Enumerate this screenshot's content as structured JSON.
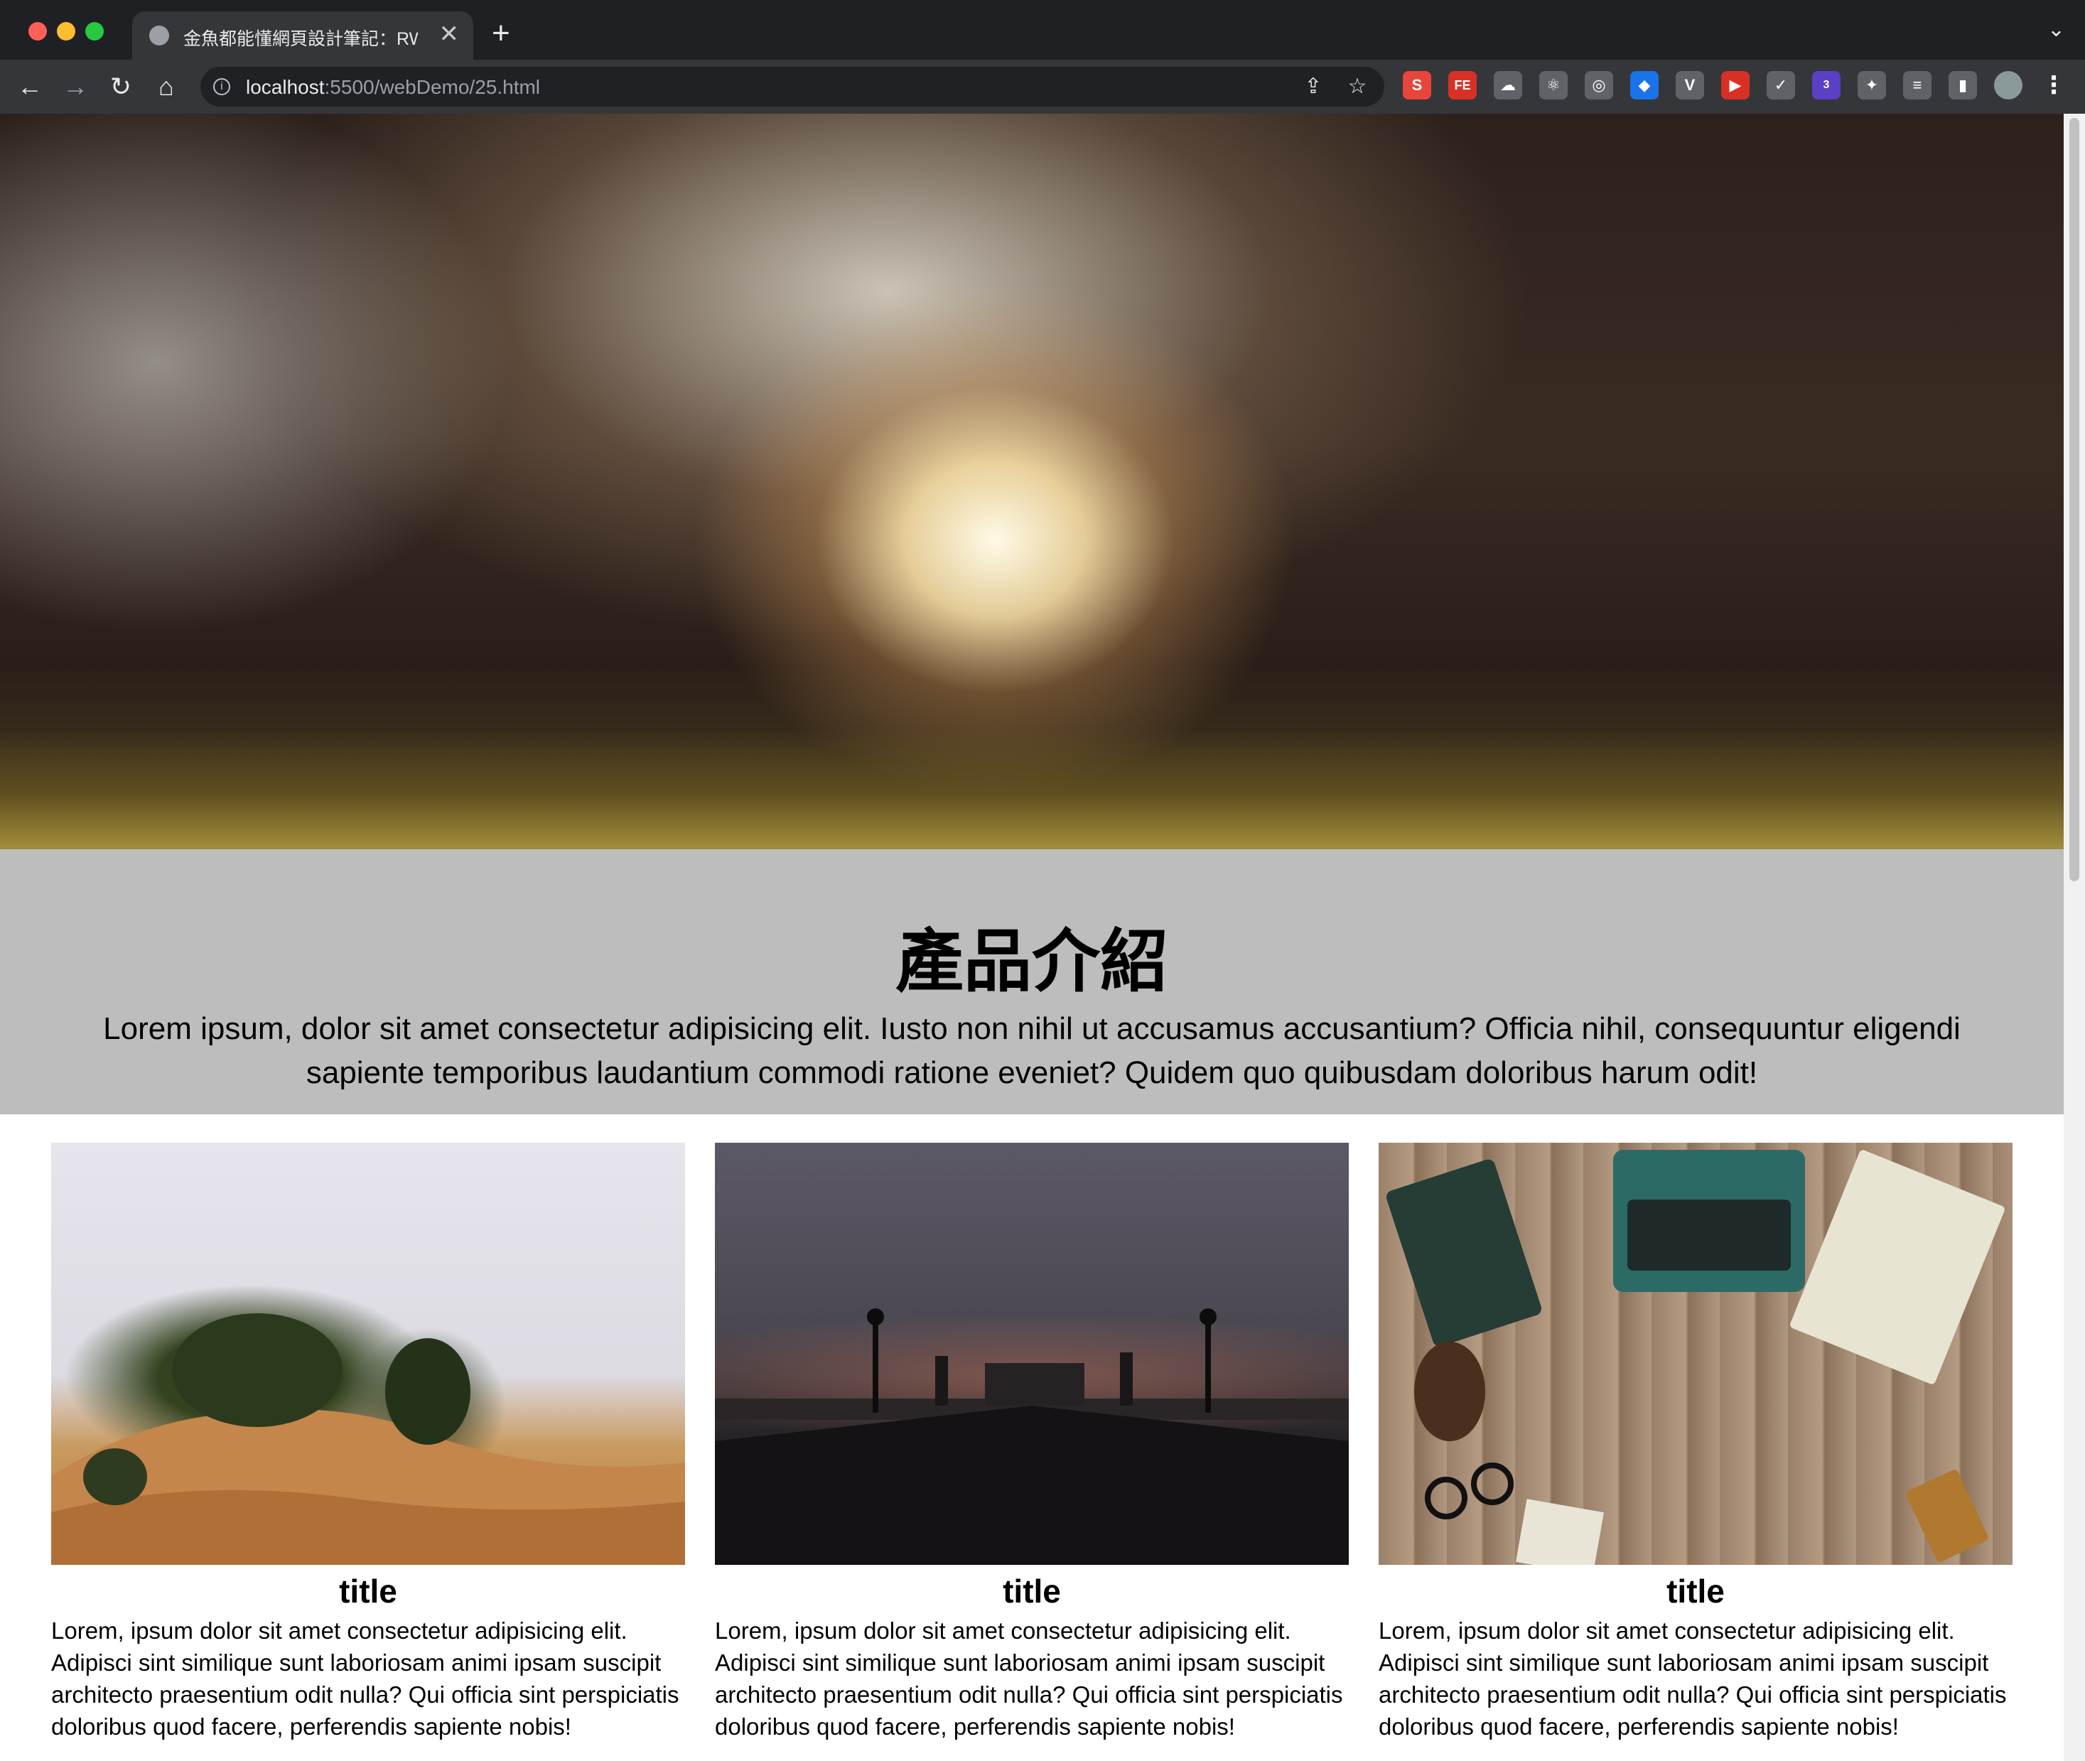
{
  "browser": {
    "tab_title": "金魚都能懂網頁設計筆記：RWD",
    "tab_close": "✕",
    "new_tab": "+",
    "tab_menu": "⌄",
    "url_host": "localhost",
    "url_path": ":5500/webDemo/25.html",
    "nav": {
      "back": "←",
      "forward": "→",
      "reload": "↻",
      "home": "⌂"
    },
    "omnibox_icons": {
      "share": "⇪",
      "bookmark": "☆"
    },
    "extensions": [
      {
        "label": "S",
        "color": "#e8453c"
      },
      {
        "label": "FE",
        "color": "#d93025"
      },
      {
        "label": "☁",
        "color": "#5f6368"
      },
      {
        "label": "⚛",
        "color": "#5f6368"
      },
      {
        "label": "◎",
        "color": "#5f6368"
      },
      {
        "label": "◆",
        "color": "#1a73e8"
      },
      {
        "label": "V",
        "color": "#5f6368"
      },
      {
        "label": "▶",
        "color": "#d93025"
      },
      {
        "label": "✓",
        "color": "#5f6368"
      },
      {
        "label": "3",
        "color": "#5b3fc4"
      },
      {
        "label": "✦",
        "color": "#5f6368"
      },
      {
        "label": "≡",
        "color": "#5f6368"
      },
      {
        "label": "▮",
        "color": "#5f6368"
      }
    ],
    "menu": "⋮"
  },
  "page": {
    "intro": {
      "heading": "產品介紹",
      "text": "Lorem ipsum, dolor sit amet consectetur adipisicing elit. Iusto non nihil ut accusamus accusantium? Officia nihil, consequuntur eligendi sapiente temporibus laudantium commodi ratione eveniet? Quidem quo quibusdam doloribus harum odit!"
    },
    "cards": [
      {
        "title": "title",
        "text": "Lorem, ipsum dolor sit amet consectetur adipisicing elit. Adipisci sint similique sunt laboriosam animi ipsam suscipit architecto praesentium odit nulla? Qui officia sint perspiciatis doloribus quod facere, perferendis sapiente nobis!"
      },
      {
        "title": "title",
        "text": "Lorem, ipsum dolor sit amet consectetur adipisicing elit. Adipisci sint similique sunt laboriosam animi ipsam suscipit architecto praesentium odit nulla? Qui officia sint perspiciatis doloribus quod facere, perferendis sapiente nobis!"
      },
      {
        "title": "title",
        "text": "Lorem, ipsum dolor sit amet consectetur adipisicing elit. Adipisci sint similique sunt laboriosam animi ipsam suscipit architecto praesentium odit nulla? Qui officia sint perspiciatis doloribus quod facere, perferendis sapiente nobis!"
      }
    ]
  }
}
